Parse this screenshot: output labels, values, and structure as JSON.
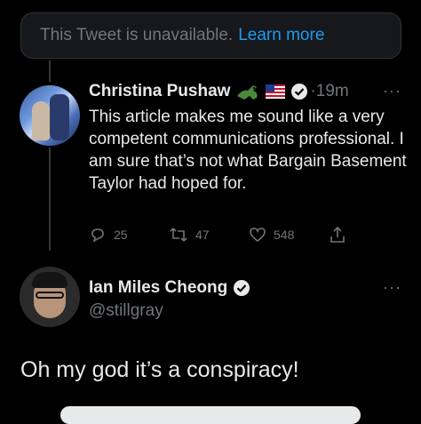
{
  "unavailable": {
    "text": "This Tweet is unavailable.",
    "link": "Learn more"
  },
  "tweet1": {
    "name": "Christina Pushaw",
    "time": "·19m",
    "text": "This article makes me sound like a very competent communications professional. I am sure that’s not what Bargain Basement Taylor had hoped for.",
    "replies": "25",
    "retweets": "47",
    "likes": "548",
    "more": "···"
  },
  "tweet2": {
    "name": "Ian Miles Cheong",
    "handle": "@stillgray",
    "more": "···",
    "text": "Oh my god it’s a conspiracy!"
  },
  "colors": {
    "accent": "#1d9bf0",
    "muted": "#71767b",
    "bg": "#000000"
  }
}
